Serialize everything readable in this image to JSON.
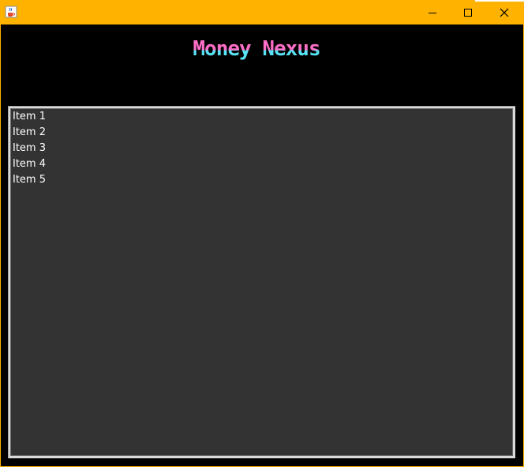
{
  "window": {
    "app_icon": "java-coffee-cup-icon",
    "controls": {
      "minimize_icon": "minimize-icon",
      "maximize_icon": "maximize-icon",
      "close_icon": "close-icon"
    },
    "titlebar_color": "#ffb300"
  },
  "header": {
    "logo_text": "Money Nexus",
    "logo_colors": [
      "#ff6ec7",
      "#57e3f5"
    ]
  },
  "list": {
    "background": "#333333",
    "items": [
      {
        "label": "Item 1"
      },
      {
        "label": "Item 2"
      },
      {
        "label": "Item 3"
      },
      {
        "label": "Item 4"
      },
      {
        "label": "Item 5"
      }
    ]
  }
}
